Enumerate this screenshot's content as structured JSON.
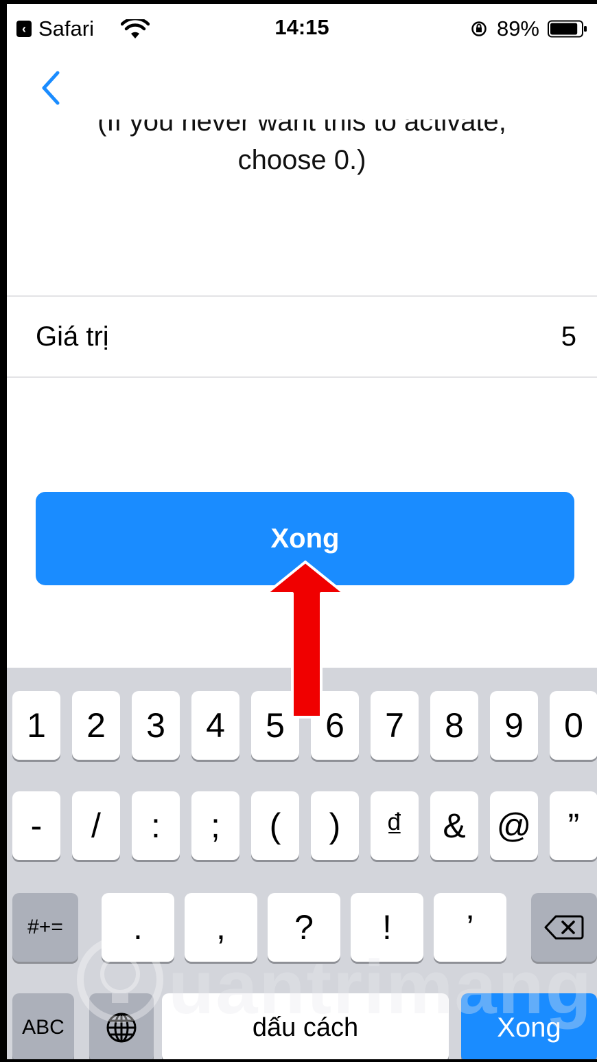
{
  "status_bar": {
    "back_app_label": "Safari",
    "time": "14:15",
    "battery_percent": "89%",
    "battery_level": 0.89
  },
  "content": {
    "description_line1": "(If you never want this to activate,",
    "description_line2": "choose 0.)",
    "value_label": "Giá trị",
    "value": "5",
    "done_button_label": "Xong"
  },
  "keyboard": {
    "row1": [
      "1",
      "2",
      "3",
      "4",
      "5",
      "6",
      "7",
      "8",
      "9",
      "0"
    ],
    "row2": [
      "-",
      "/",
      ":",
      ";",
      "(",
      ")",
      "₫",
      "&",
      "@",
      "”"
    ],
    "row3_mode": "#+=",
    "row3": [
      ".",
      ",",
      "?",
      "!",
      "’"
    ],
    "abc_label": "ABC",
    "space_label": "dấu cách",
    "return_label": "Xong"
  },
  "watermark": {
    "text": "uantrimang"
  },
  "colors": {
    "accent": "#1a8cff",
    "keyboard_bg": "#d3d5db",
    "annotation_arrow": "#f00000"
  }
}
